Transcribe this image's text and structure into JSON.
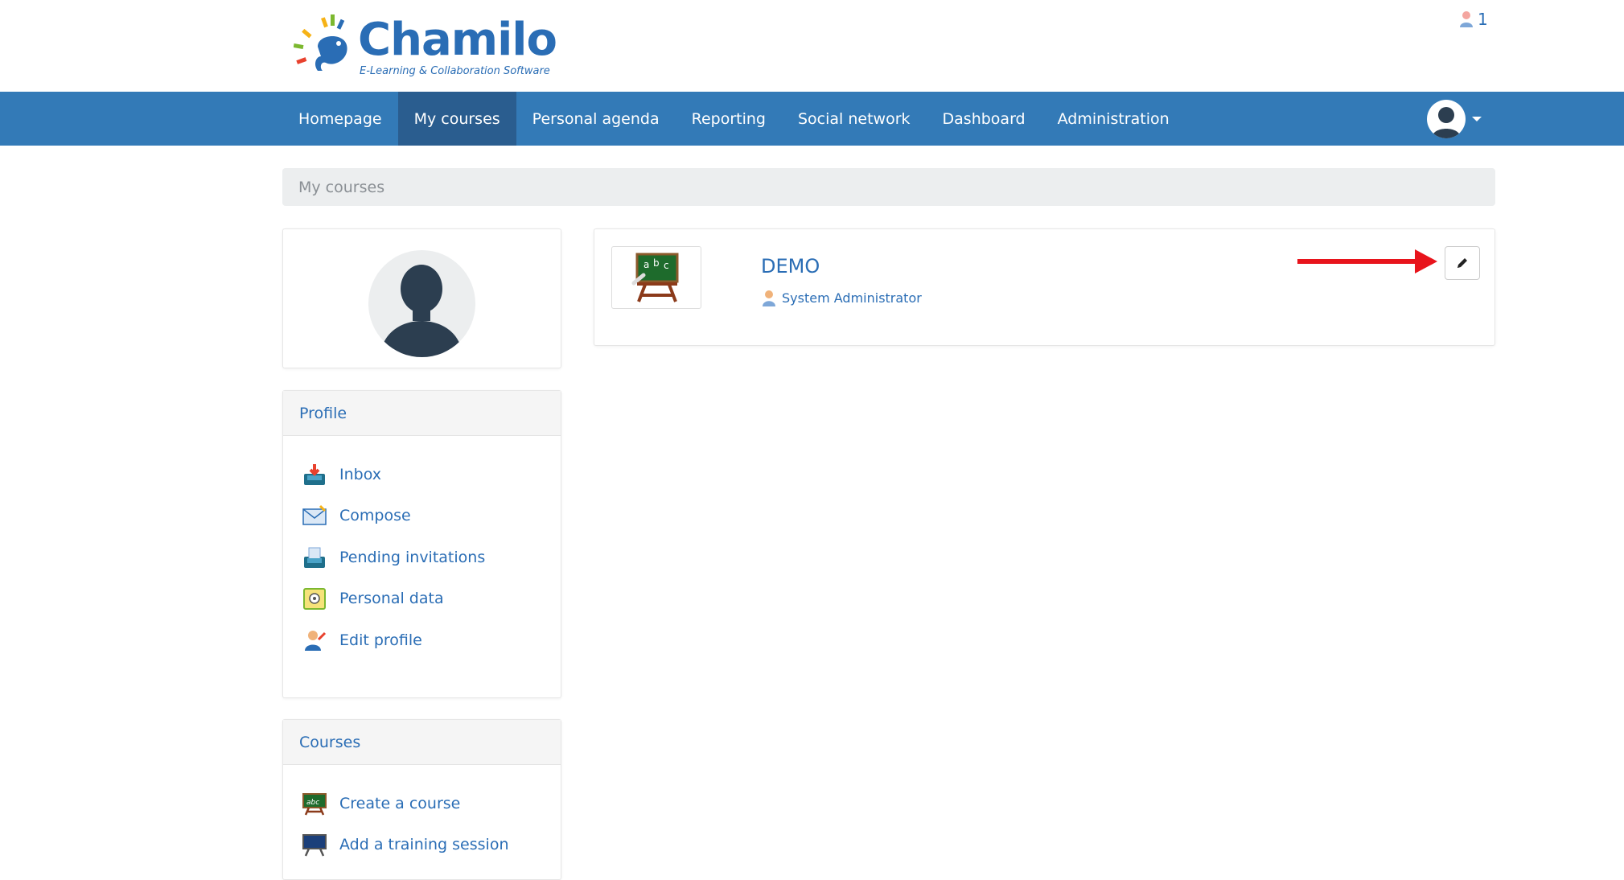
{
  "brand": {
    "name": "Chamilo",
    "tagline": "E-Learning & Collaboration Software",
    "logo_colors": [
      "#e8412d",
      "#f6b216",
      "#7cb82f",
      "#2a6db5"
    ]
  },
  "notifications": {
    "icon": "user-group-icon",
    "count": "1"
  },
  "nav": {
    "items": [
      {
        "label": "Homepage",
        "active": false
      },
      {
        "label": "My courses",
        "active": true
      },
      {
        "label": "Personal agenda",
        "active": false
      },
      {
        "label": "Reporting",
        "active": false
      },
      {
        "label": "Social network",
        "active": false
      },
      {
        "label": "Dashboard",
        "active": false
      },
      {
        "label": "Administration",
        "active": false
      }
    ],
    "user_icon": "user-avatar-icon"
  },
  "breadcrumb": {
    "current": "My courses"
  },
  "profile": {
    "title": "Profile",
    "items": [
      {
        "label": "Inbox",
        "icon": "inbox-icon"
      },
      {
        "label": "Compose",
        "icon": "compose-mail-icon"
      },
      {
        "label": "Pending invitations",
        "icon": "invitations-icon"
      },
      {
        "label": "Personal data",
        "icon": "personal-data-icon"
      },
      {
        "label": "Edit profile",
        "icon": "edit-profile-icon"
      }
    ]
  },
  "courses_block": {
    "title": "Courses",
    "items": [
      {
        "label": "Create a course",
        "icon": "create-course-icon"
      },
      {
        "label": "Add a training session",
        "icon": "training-session-icon"
      }
    ]
  },
  "course": {
    "title": "DEMO",
    "teacher": "System Administrator",
    "thumb_icon": "blackboard-icon",
    "edit_icon": "pencil-icon"
  },
  "colors": {
    "primary": "#337ab7",
    "nav_active": "#2a5d8f",
    "link": "#2a6db5",
    "arrow": "#e8141c"
  }
}
